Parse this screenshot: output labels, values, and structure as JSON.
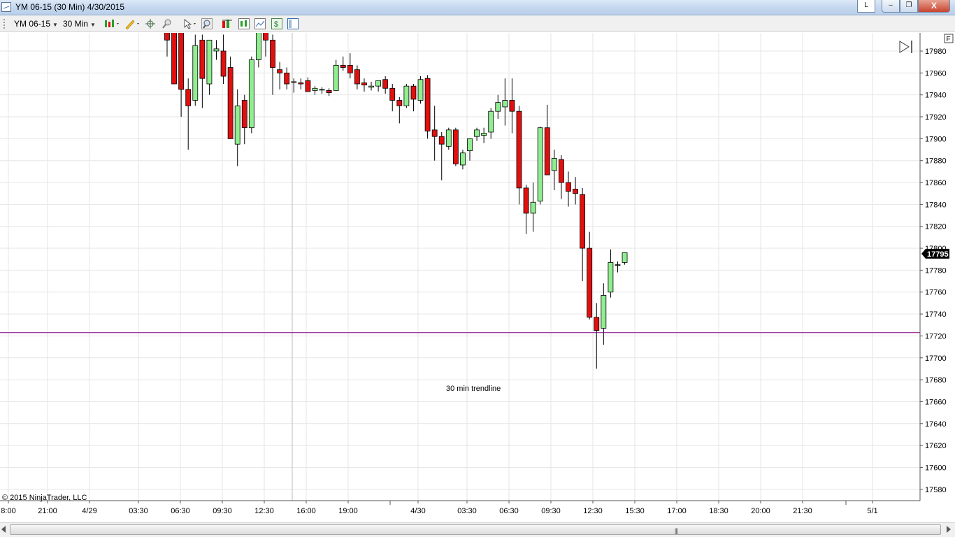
{
  "window": {
    "title": "YM 06-15 (30 Min)  4/30/2015",
    "buttons": {
      "l_label": "L",
      "minimize": "‒",
      "maximize": "❐",
      "close": "X"
    }
  },
  "toolbar": {
    "instrument": "YM 06-15",
    "interval": "30 Min",
    "icons": [
      "candlestick-style-icon",
      "pencil-draw-icon",
      "crosshair-icon",
      "zoom-out-icon",
      "pointer-icon",
      "zoom-in-icon",
      "indicators-icon",
      "strategies-icon",
      "chart-properties-icon",
      "dollar-icon",
      "data-box-icon"
    ]
  },
  "chart": {
    "copyright": "© 2015 NinjaTrader, LLC",
    "annotation": "30 min trendline",
    "price_badge": "17795",
    "f_marker": "F",
    "accent_colors": {
      "up_candle": "#90EE90",
      "down_candle": "#E01010",
      "trendline": "#800080",
      "badge": "#000000"
    }
  },
  "chart_data": {
    "type": "candlestick",
    "y_ticks": [
      "17980",
      "17960",
      "17940",
      "17920",
      "17900",
      "17880",
      "17860",
      "17840",
      "17820",
      "17800",
      "17780",
      "17760",
      "17740",
      "17720",
      "17700",
      "17680",
      "17660",
      "17640",
      "17620",
      "17600",
      "17580"
    ],
    "ylim": [
      17575,
      17985
    ],
    "x_ticks": [
      "8:00",
      "21:00",
      "4/29",
      "03:30",
      "06:30",
      "09:30",
      "12:30",
      "16:00",
      "19:00",
      "4/30",
      "03:30",
      "06:30",
      "09:30",
      "12:30",
      "15:30",
      "17:00",
      "18:30",
      "20:00",
      "21:30",
      "5/1"
    ],
    "current_price": 17795,
    "trendline_price": 17723,
    "candles": [
      [
        18030,
        18040,
        17975,
        17990
      ],
      [
        18010,
        18020,
        17960,
        17950
      ],
      [
        18020,
        18030,
        17920,
        17945
      ],
      [
        17945,
        17955,
        17890,
        17930
      ],
      [
        17935,
        17995,
        17930,
        17985
      ],
      [
        17990,
        17995,
        17928,
        17955
      ],
      [
        17950,
        17990,
        17940,
        17990
      ],
      [
        17980,
        17990,
        17972,
        17982
      ],
      [
        17980,
        17995,
        17950,
        17957
      ],
      [
        17965,
        17975,
        17910,
        17900
      ],
      [
        17895,
        17945,
        17875,
        17930
      ],
      [
        17935,
        17940,
        17895,
        17910
      ],
      [
        17910,
        17975,
        17905,
        17972
      ],
      [
        17972,
        18010,
        17965,
        18000
      ],
      [
        18000,
        18010,
        17975,
        17990
      ],
      [
        17990,
        17995,
        17940,
        17965
      ],
      [
        17963,
        17970,
        17945,
        17960
      ],
      [
        17960,
        17965,
        17945,
        17950
      ],
      [
        17952,
        17955,
        17942,
        17952
      ],
      [
        17951,
        17955,
        17945,
        17950
      ],
      [
        17953,
        17956,
        17943,
        17943
      ],
      [
        17944,
        17948,
        17940,
        17946
      ],
      [
        17945,
        17947,
        17941,
        17945
      ],
      [
        17944,
        17946,
        17939,
        17942
      ],
      [
        17944,
        17972,
        17944,
        17967
      ],
      [
        17967,
        17975,
        17962,
        17965
      ],
      [
        17967,
        17978,
        17955,
        17960
      ],
      [
        17963,
        17967,
        17945,
        17950
      ],
      [
        17951,
        17955,
        17943,
        17949
      ],
      [
        17947,
        17952,
        17944,
        17948
      ],
      [
        17948,
        17952,
        17943,
        17953
      ],
      [
        17954,
        17957,
        17941,
        17946
      ],
      [
        17946,
        17950,
        17925,
        17935
      ],
      [
        17935,
        17938,
        17914,
        17930
      ],
      [
        17930,
        17950,
        17928,
        17948
      ],
      [
        17948,
        17950,
        17925,
        17936
      ],
      [
        17935,
        17957,
        17932,
        17954
      ],
      [
        17955,
        17958,
        17900,
        17907
      ],
      [
        17908,
        17930,
        17880,
        17902
      ],
      [
        17902,
        17906,
        17862,
        17895
      ],
      [
        17893,
        17910,
        17890,
        17908
      ],
      [
        17908,
        17910,
        17875,
        17877
      ],
      [
        17876,
        17890,
        17872,
        17887
      ],
      [
        17889,
        17900,
        17880,
        17900
      ],
      [
        17902,
        17910,
        17898,
        17908
      ],
      [
        17903,
        17910,
        17896,
        17905
      ],
      [
        17906,
        17928,
        17900,
        17925
      ],
      [
        17925,
        17940,
        17918,
        17933
      ],
      [
        17929,
        17955,
        17912,
        17935
      ],
      [
        17935,
        17955,
        17905,
        17925
      ],
      [
        17925,
        17930,
        17840,
        17855
      ],
      [
        17855,
        17858,
        17813,
        17832
      ],
      [
        17832,
        17860,
        17815,
        17842
      ],
      [
        17843,
        17911,
        17840,
        17910
      ],
      [
        17910,
        17931,
        17868,
        17867
      ],
      [
        17871,
        17890,
        17853,
        17882
      ],
      [
        17881,
        17885,
        17845,
        17860
      ],
      [
        17860,
        17870,
        17838,
        17852
      ],
      [
        17854,
        17865,
        17840,
        17850
      ],
      [
        17849,
        17855,
        17770,
        17800
      ],
      [
        17800,
        17815,
        17735,
        17737
      ],
      [
        17737,
        17750,
        17690,
        17725
      ],
      [
        17727,
        17768,
        17712,
        17757
      ],
      [
        17760,
        17799,
        17755,
        17787
      ],
      [
        17785,
        17788,
        17778,
        17785
      ],
      [
        17787,
        17796,
        17785,
        17796
      ]
    ]
  }
}
